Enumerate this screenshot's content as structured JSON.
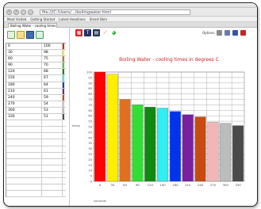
{
  "browser": {
    "url": "file:///C:/Users/.../boilingwater.html",
    "nav_back": "‹",
    "nav_forward": "›",
    "favorites": [
      "Most Visited",
      "Getting Started",
      "Latest Headlines",
      "Smart Bkm"
    ],
    "tab_title": "Boiling Water - cooling times in degrees C"
  },
  "toolbar": {
    "icons": [
      "new-file-icon",
      "open-folder-icon",
      "save-icon",
      "export-icon"
    ],
    "colors": [
      "#6aa84f",
      "#e6b800",
      "#2b6cb0",
      "#38a169"
    ]
  },
  "chart_toolbar": {
    "icons": [
      "table-icon",
      "font-icon",
      "data-icon",
      "line-chart-icon",
      "pie-chart-icon"
    ]
  },
  "right_tools": {
    "label": "Options",
    "colors": [
      "#8a8a8a",
      "#6a7ab0",
      "#3355aa",
      "#cc2222"
    ]
  },
  "table": {
    "rows": [
      {
        "x": "0",
        "y": "100",
        "color": "#ff0000"
      },
      {
        "x": "30",
        "y": "98",
        "color": "#ffee00"
      },
      {
        "x": "60",
        "y": "75",
        "color": "#e07020"
      },
      {
        "x": "90",
        "y": "70",
        "color": "#33dd33"
      },
      {
        "x": "120",
        "y": "68",
        "color": "#118811"
      },
      {
        "x": "150",
        "y": "67",
        "color": "#33eeee"
      },
      {
        "x": "180",
        "y": "64",
        "color": "#0033ee"
      },
      {
        "x": "210",
        "y": "61",
        "color": "#7a1fa0"
      },
      {
        "x": "240",
        "y": "59",
        "color": "#c84a10"
      },
      {
        "x": "270",
        "y": "54",
        "color": "#f2b6b6"
      },
      {
        "x": "300",
        "y": "53",
        "color": "#bcbcbc"
      },
      {
        "x": "330",
        "y": "51",
        "color": "#4a4a4a"
      },
      {
        "x": "",
        "y": "",
        "color": "#ffffff"
      },
      {
        "x": "",
        "y": "",
        "color": "#ffffff"
      },
      {
        "x": "",
        "y": "",
        "color": "#ffffff"
      },
      {
        "x": "",
        "y": "",
        "color": "#ffffff"
      },
      {
        "x": "",
        "y": "",
        "color": "#ffffff"
      },
      {
        "x": "",
        "y": "",
        "color": "#ffffff"
      },
      {
        "x": "",
        "y": "",
        "color": "#ffffff"
      },
      {
        "x": "",
        "y": "",
        "color": "#ffffff"
      },
      {
        "x": "",
        "y": "",
        "color": "#ffffff"
      },
      {
        "x": "",
        "y": "",
        "color": "#ffffff"
      },
      {
        "x": "",
        "y": "",
        "color": "#ffffff"
      },
      {
        "x": "",
        "y": "",
        "color": "#ffffff"
      }
    ]
  },
  "chart_data": {
    "type": "bar",
    "title": "Boiling Water - cooling times in degrees C",
    "xlabel": "seconds",
    "ylabel": "temp",
    "categories": [
      "0",
      "30",
      "60",
      "90",
      "120",
      "150",
      "180",
      "210",
      "240",
      "270",
      "300",
      "330"
    ],
    "values": [
      100,
      98,
      75,
      70,
      68,
      67,
      64,
      61,
      59,
      54,
      53,
      51
    ],
    "colors": [
      "#ff0000",
      "#ffee00",
      "#e07020",
      "#33dd33",
      "#118811",
      "#33eeee",
      "#0033ee",
      "#7a1fa0",
      "#c84a10",
      "#f2b6b6",
      "#bcbcbc",
      "#4a4a4a"
    ],
    "ylim": [
      0,
      100
    ],
    "yticks": [
      0,
      5,
      10,
      15,
      20,
      25,
      30,
      35,
      40,
      45,
      50,
      55,
      60,
      65,
      70,
      75,
      80,
      85,
      90,
      95,
      100
    ],
    "grid": true,
    "legend": "none"
  }
}
